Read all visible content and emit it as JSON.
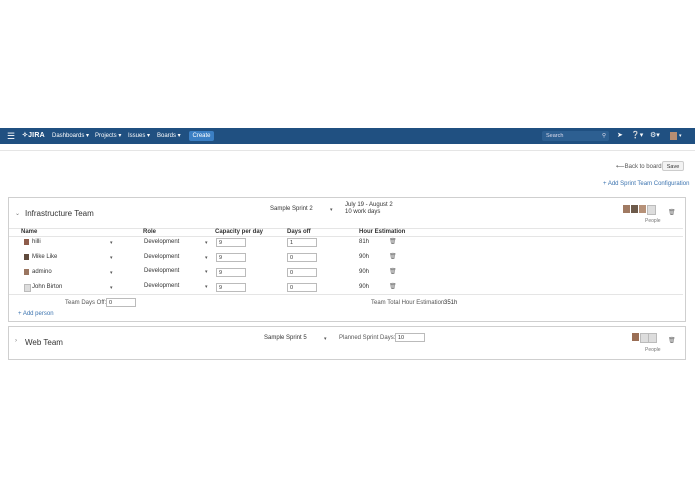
{
  "topnav": {
    "menu_icon": "menu-icon",
    "logo": "JIRA",
    "items": [
      "Dashboards",
      "Projects",
      "Issues",
      "Boards"
    ],
    "create_label": "Create",
    "search_placeholder": "Search",
    "bg_color": "#205081"
  },
  "toolbar": {
    "back_label": "Back to board",
    "save_label": "Save",
    "add_config_label": "+ Add Sprint Team Configuration"
  },
  "team1": {
    "name": "Infrastructure Team",
    "sprint": "Sample Sprint 2",
    "dates": "July 19 - August 2",
    "work_days": "10 work days",
    "people_label": "People",
    "columns": [
      "Name",
      "Role",
      "Capacity per day",
      "Days off",
      "Hour Estimation"
    ],
    "members": [
      {
        "name": "hilli",
        "role": "Development",
        "capacity": "9",
        "days_off": "1",
        "hours": "81h"
      },
      {
        "name": "Mike Like",
        "role": "Development",
        "capacity": "9",
        "days_off": "0",
        "hours": "90h"
      },
      {
        "name": "admino",
        "role": "Development",
        "capacity": "9",
        "days_off": "0",
        "hours": "90h"
      },
      {
        "name": "John Birton",
        "role": "Development",
        "capacity": "9",
        "days_off": "0",
        "hours": "90h"
      }
    ],
    "team_days_off_label": "Team Days Off:",
    "team_days_off": "0",
    "total_label": "Team Total Hour Estimation:",
    "total_value": "351h",
    "add_person": "+ Add person"
  },
  "team2": {
    "name": "Web Team",
    "sprint": "Sample Sprint 5",
    "planned_label": "Planned Sprint Days:",
    "planned_value": "10",
    "people_label": "People"
  }
}
